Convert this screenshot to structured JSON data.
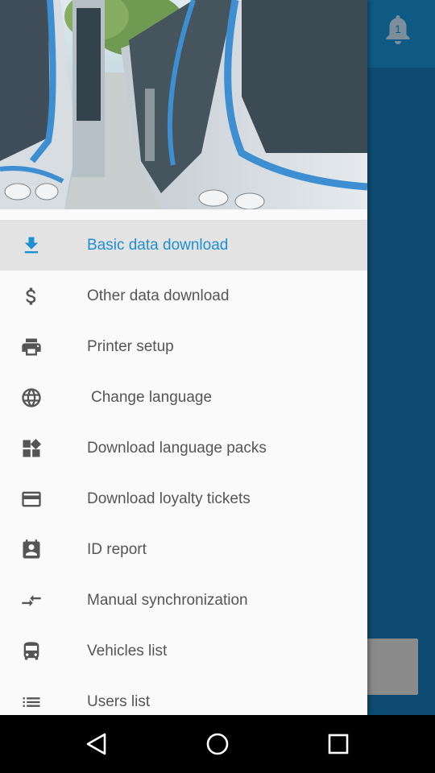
{
  "notifications": {
    "count": "1",
    "icon": "bell-icon"
  },
  "drawer": {
    "items": [
      {
        "label": "Basic data download",
        "icon": "download-icon",
        "active": true
      },
      {
        "label": "Other data download",
        "icon": "dollar-icon"
      },
      {
        "label": "Printer setup",
        "icon": "printer-icon"
      },
      {
        "label": "Change language",
        "icon": "globe-icon"
      },
      {
        "label": "Download language packs",
        "icon": "widgets-icon"
      },
      {
        "label": "Download loyalty tickets",
        "icon": "card-icon"
      },
      {
        "label": "ID report",
        "icon": "badge-icon"
      },
      {
        "label": "Manual synchronization",
        "icon": "sync-arrows-icon"
      },
      {
        "label": "Vehicles list",
        "icon": "bus-icon"
      },
      {
        "label": "Users list",
        "icon": "list-icon"
      }
    ]
  },
  "colors": {
    "accent": "#1e8fd2",
    "app_background": "#0e4c72",
    "drawer_background": "#fafafa",
    "active_item": "#e3e3e3"
  }
}
